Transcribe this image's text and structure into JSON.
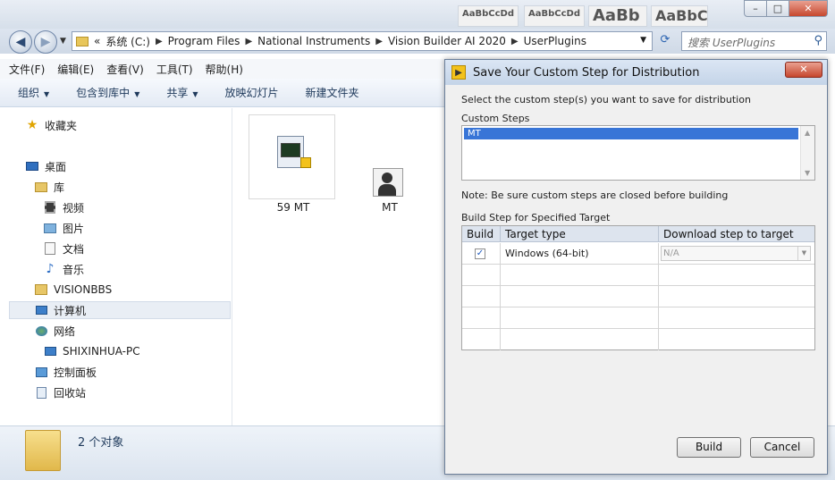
{
  "explorer": {
    "title_previews": [
      "AaBbCcDd",
      "AaBbCcDd",
      "AaBb",
      "AaBbC"
    ],
    "nav": {
      "breadcrumbs": [
        "系统 (C:)",
        "Program Files",
        "National Instruments",
        "Vision Builder AI 2020",
        "UserPlugins"
      ],
      "overflow": "«",
      "search_placeholder": "搜索 UserPlugins"
    },
    "menu": [
      "文件(F)",
      "编辑(E)",
      "查看(V)",
      "工具(T)",
      "帮助(H)"
    ],
    "toolbar": [
      "组织",
      "包含到库中",
      "共享",
      "放映幻灯片",
      "新建文件夹"
    ],
    "sidebar": {
      "favorites": "收藏夹",
      "desktop": "桌面",
      "library": "库",
      "videos": "视频",
      "pictures": "图片",
      "documents": "文档",
      "music": "音乐",
      "visionbbs": "VISIONBBS",
      "computer": "计算机",
      "network": "网络",
      "pc": "SHIXINHUA-PC",
      "control_panel": "控制面板",
      "recycle_bin": "回收站"
    },
    "files": [
      {
        "name": "59 MT",
        "icon": "vision-builder-file-icon"
      },
      {
        "name": "MT",
        "icon": "user-tool-folder-icon"
      }
    ],
    "status": "2 个对象"
  },
  "dialog": {
    "title": "Save Your Custom Step for Distribution",
    "instruction": "Select the custom step(s) you want to save for distribution",
    "custom_steps_label": "Custom Steps",
    "custom_steps": [
      "MT"
    ],
    "note": "Note:  Be sure custom steps are closed before building",
    "build_label": "Build Step for Specified Target",
    "grid": {
      "headers": [
        "Build",
        "Target type",
        "Download step to target"
      ],
      "rows": [
        {
          "build": "✓",
          "target": "Windows (64-bit)",
          "download": "N/A"
        }
      ]
    },
    "build_button": "Build",
    "cancel_button": "Cancel"
  }
}
